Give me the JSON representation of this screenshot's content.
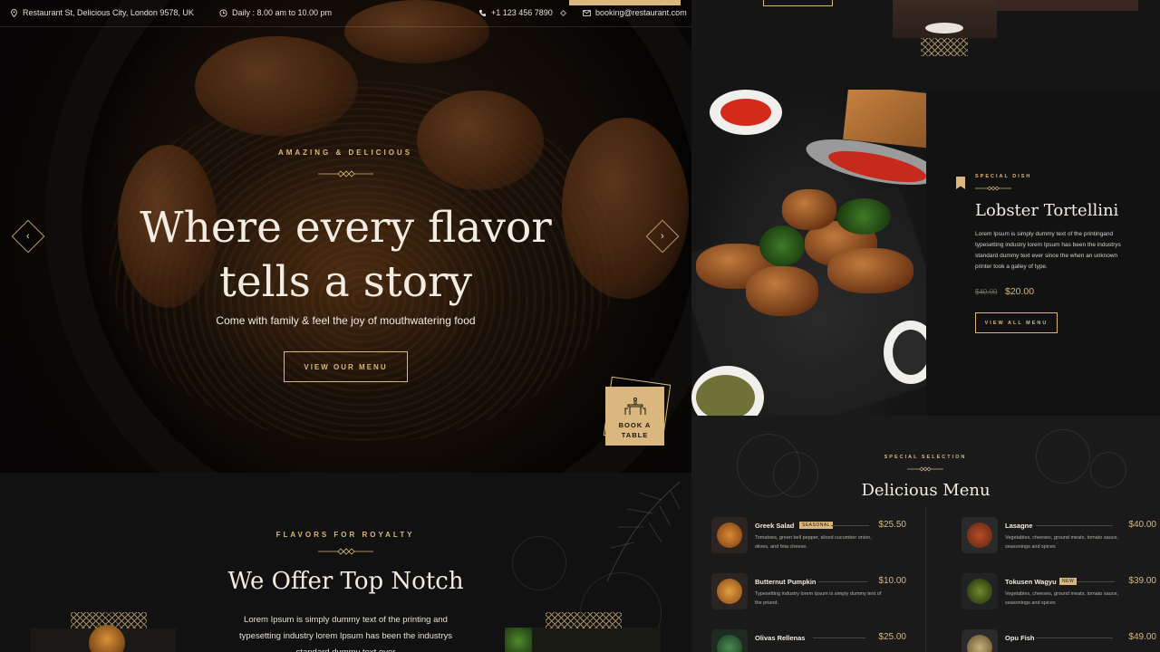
{
  "topbar": {
    "address": "Restaurant St, Delicious City, London 9578, UK",
    "hours": "Daily : 8.00 am to 10.00 pm",
    "phone": "+1 123 456 7890",
    "email": "booking@restaurant.com"
  },
  "hero": {
    "eyebrow": "AMAZING & DELICIOUS",
    "title_line1": "Where every flavor",
    "title_line2": "tells a story",
    "subtitle": "Come with family & feel the joy of mouthwatering food",
    "cta": "VIEW OUR MENU",
    "prev_icon": "‹",
    "next_icon": "›",
    "book_label_1": "BOOK A",
    "book_label_2": "TABLE"
  },
  "offer": {
    "eyebrow": "FLAVORS FOR ROYALTY",
    "title": "We Offer Top Notch",
    "text": "Lorem Ipsum is simply dummy text of the printing and typesetting industry lorem Ipsum has been the industrys standard dummy text ever"
  },
  "special": {
    "eyebrow": "SPECIAL DISH",
    "name": "Lobster Tortellini",
    "description": "Lorem Ipsum is simply dummy text of the printingand typesetting industry lorem Ipsum has been the industrys standard dummy text ever since the when an unknown printer took a galley of type.",
    "old_price": "$40.00",
    "new_price": "$20.00",
    "cta": "VIEW ALL MENU"
  },
  "menu": {
    "eyebrow": "SPECIAL SELECTION",
    "title": "Delicious Menu",
    "items": [
      {
        "name": "Greek Salad",
        "tag": "SEASONAL",
        "price": "$25.50",
        "desc": "Tomatoes, green bell pepper, sliced cucumber onion, olives, and feta cheese."
      },
      {
        "name": "Lasagne",
        "tag": "",
        "price": "$40.00",
        "desc": "Vegetables, cheeses, ground meats, tomato sauce, seasonings and spices"
      },
      {
        "name": "Butternut Pumpkin",
        "tag": "",
        "price": "$10.00",
        "desc": "Typesetting industry lorem Ipsum is simply dummy text of the priand."
      },
      {
        "name": "Tokusen Wagyu",
        "tag": "NEW",
        "price": "$39.00",
        "desc": "Vegetables, cheeses, ground meats, tomato sauce, seasonings and spices"
      },
      {
        "name": "Olivas Rellenas",
        "tag": "",
        "price": "$25.00",
        "desc": ""
      },
      {
        "name": "Opu Fish",
        "tag": "",
        "price": "$49.00",
        "desc": ""
      }
    ]
  },
  "colors": {
    "accent": "#d9b77e",
    "background": "#0d0d0d",
    "panel": "#141414"
  }
}
